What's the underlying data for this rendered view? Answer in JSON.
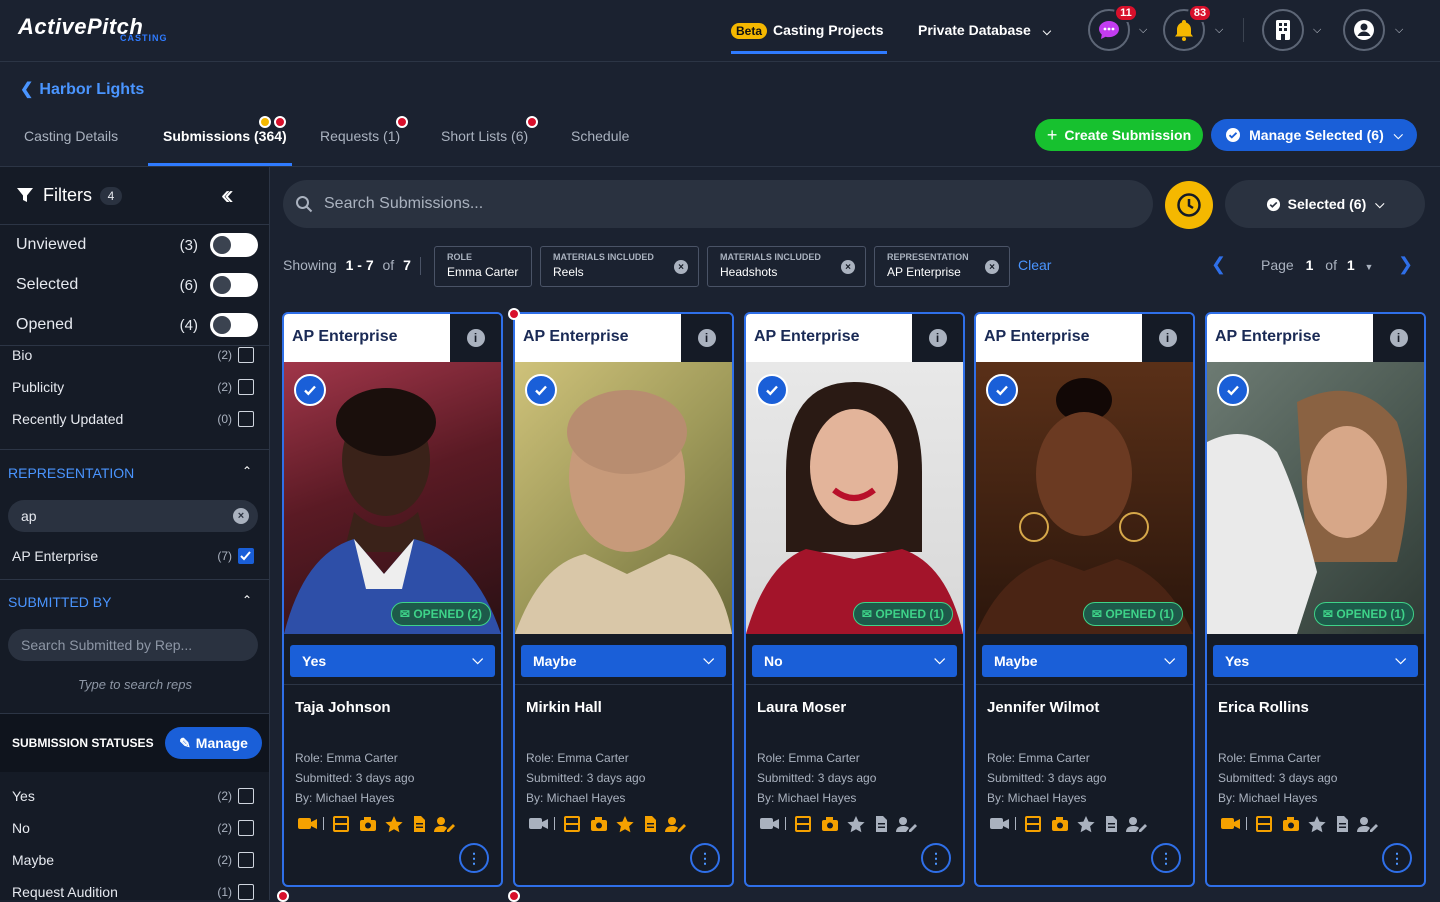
{
  "app": {
    "logo_main": "ActivePitch",
    "logo_sub": "CASTING"
  },
  "topnav": {
    "beta_label": "Beta",
    "casting_projects": "Casting Projects",
    "private_database": "Private Database",
    "messages_count": "11",
    "notifications_count": "83"
  },
  "project": {
    "back_label": "Harbor Lights"
  },
  "tabs": [
    {
      "label": "Casting Details"
    },
    {
      "label": "Submissions (364)"
    },
    {
      "label": "Requests (1)"
    },
    {
      "label": "Short Lists (6)"
    },
    {
      "label": "Schedule"
    }
  ],
  "actions": {
    "create": "Create Submission",
    "manage_selected": "Manage Selected (6)"
  },
  "sidebar": {
    "filters_label": "Filters",
    "filters_count": "4",
    "toggles": [
      {
        "label": "Unviewed",
        "count": "(3)"
      },
      {
        "label": "Selected",
        "count": "(6)"
      },
      {
        "label": "Opened",
        "count": "(4)"
      }
    ],
    "misc": [
      {
        "label": "Bio",
        "count": "(2)"
      },
      {
        "label": "Publicity",
        "count": "(2)"
      },
      {
        "label": "Recently Updated",
        "count": "(0)"
      }
    ],
    "representation": {
      "title": "REPRESENTATION",
      "search_value": "ap",
      "items": [
        {
          "label": "AP Enterprise",
          "count": "(7)"
        }
      ]
    },
    "submitted_by": {
      "title": "SUBMITTED BY",
      "placeholder": "Search Submitted by Rep...",
      "hint": "Type to search reps"
    },
    "statuses": {
      "title": "SUBMISSION STATUSES",
      "manage": "Manage",
      "items": [
        {
          "label": "Yes",
          "count": "(2)"
        },
        {
          "label": "No",
          "count": "(2)"
        },
        {
          "label": "Maybe",
          "count": "(2)"
        },
        {
          "label": "Request Audition",
          "count": "(1)"
        }
      ]
    }
  },
  "search": {
    "placeholder": "Search Submissions...",
    "selected_label": "Selected (6)"
  },
  "results": {
    "showing": "Showing",
    "range": "1 - 7",
    "of": "of",
    "total": "7",
    "clear": "Clear",
    "page_label": "Page",
    "page": "1",
    "page_total": "1"
  },
  "chips": [
    {
      "key": "ROLE",
      "value": "Emma Carter"
    },
    {
      "key": "MATERIALS INCLUDED",
      "value": "Reels"
    },
    {
      "key": "MATERIALS INCLUDED",
      "value": "Headshots"
    },
    {
      "key": "REPRESENTATION",
      "value": "AP Enterprise"
    }
  ],
  "cards": [
    {
      "agency": "AP Enterprise",
      "opened": "OPENED (2)",
      "status": "Yes",
      "name": "Taja Johnson",
      "role": "Role: Emma Carter",
      "submitted": "Submitted: 3 days ago",
      "by": "By: Michael Hayes"
    },
    {
      "agency": "AP Enterprise",
      "opened": "",
      "status": "Maybe",
      "name": "Mirkin Hall",
      "role": "Role: Emma Carter",
      "submitted": "Submitted: 3 days ago",
      "by": "By: Michael Hayes"
    },
    {
      "agency": "AP Enterprise",
      "opened": "OPENED (1)",
      "status": "No",
      "name": "Laura Moser",
      "role": "Role: Emma Carter",
      "submitted": "Submitted: 3 days ago",
      "by": "By: Michael Hayes"
    },
    {
      "agency": "AP Enterprise",
      "opened": "OPENED (1)",
      "status": "Maybe",
      "name": "Jennifer Wilmot",
      "role": "Role: Emma Carter",
      "submitted": "Submitted: 3 days ago",
      "by": "By: Michael Hayes"
    },
    {
      "agency": "AP Enterprise",
      "opened": "OPENED (1)",
      "status": "Yes",
      "name": "Erica Rollins",
      "role": "Role: Emma Carter",
      "submitted": "Submitted: 3 days ago",
      "by": "By: Michael Hayes"
    }
  ],
  "colors": {
    "accent": "#2f7bff",
    "brand_green": "#17c12f",
    "brand_blue": "#1a5fd8",
    "alert_red": "#d8102b",
    "warning": "#f5b800"
  }
}
